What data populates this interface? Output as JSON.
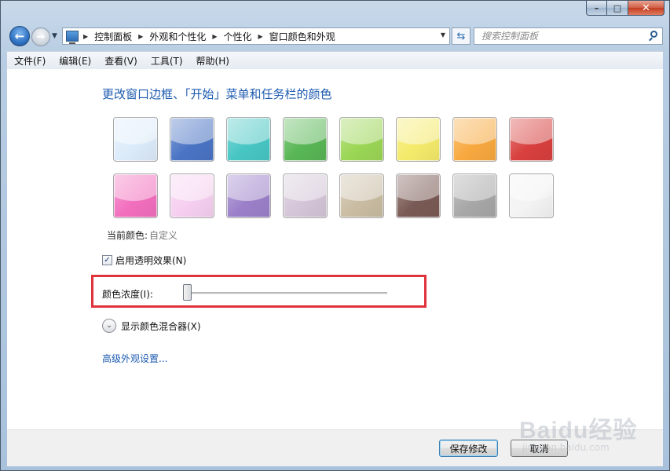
{
  "window": {
    "caption": {
      "min": "–",
      "max": "□",
      "close": "✕"
    }
  },
  "nav": {
    "breadcrumbs": [
      "控制面板",
      "外观和个性化",
      "个性化",
      "窗口颜色和外观"
    ],
    "search_placeholder": "搜索控制面板"
  },
  "menu": [
    "文件(F)",
    "编辑(E)",
    "查看(V)",
    "工具(T)",
    "帮助(H)"
  ],
  "main": {
    "heading": "更改窗口边框、「开始」菜单和任务栏的颜色",
    "swatches": [
      {
        "name": "sky",
        "color": "#dcebfa"
      },
      {
        "name": "twilight",
        "color": "#4a74c4"
      },
      {
        "name": "sea",
        "color": "#47c6c4"
      },
      {
        "name": "leaf",
        "color": "#58b655"
      },
      {
        "name": "lime",
        "color": "#9bd655"
      },
      {
        "name": "lemon",
        "color": "#f4ea6a"
      },
      {
        "name": "tangerine",
        "color": "#f8a93f"
      },
      {
        "name": "ruby",
        "color": "#d8403e"
      },
      {
        "name": "fuchsia",
        "color": "#f26fbe"
      },
      {
        "name": "blush",
        "color": "#f6cff0"
      },
      {
        "name": "violet",
        "color": "#9b80c9"
      },
      {
        "name": "lavender",
        "color": "#d4c5d8"
      },
      {
        "name": "taupe",
        "color": "#c9bca2"
      },
      {
        "name": "chocolate",
        "color": "#7a5a54"
      },
      {
        "name": "slate",
        "color": "#a7a7a7"
      },
      {
        "name": "frost",
        "color": "#f3f3f3"
      }
    ],
    "current_label": "当前颜色:",
    "current_value": "自定义",
    "transparency_label": "启用透明效果(N)",
    "transparency_checked": true,
    "intensity_label": "颜色浓度(I):",
    "intensity_value": 0.0,
    "mixer_label": "显示颜色混合器(X)",
    "advanced_link": "高级外观设置..."
  },
  "footer": {
    "save": "保存修改",
    "cancel": "取消"
  },
  "watermark": {
    "text": "Baidu经验",
    "url": "jingyan.baidu.com"
  },
  "colors": {
    "accent": "#1e5bb0",
    "highlight_box": "#e0323a"
  }
}
